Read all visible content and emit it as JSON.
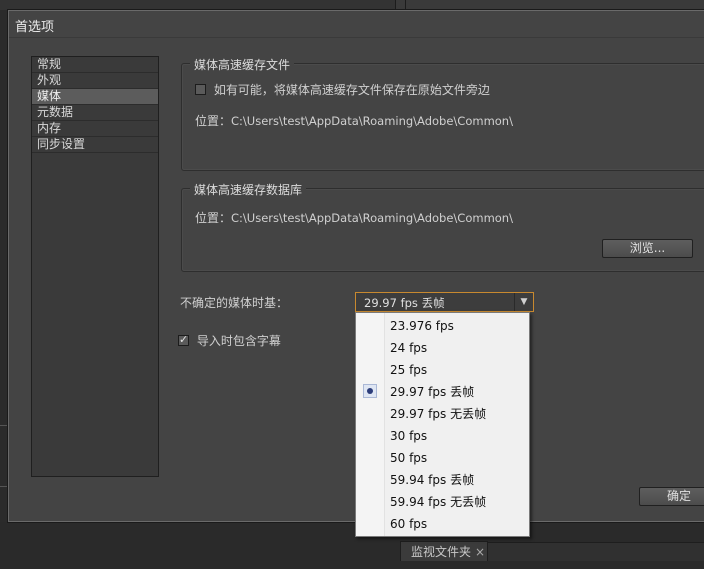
{
  "dialog": {
    "title": "首选项",
    "sidebar": {
      "items": [
        {
          "label": "常规"
        },
        {
          "label": "外观"
        },
        {
          "label": "媒体",
          "selected": true
        },
        {
          "label": "元数据"
        },
        {
          "label": "内存"
        },
        {
          "label": "同步设置"
        }
      ]
    },
    "media_cache_files": {
      "title": "媒体高速缓存文件",
      "save_next_to_originals": {
        "label": "如有可能，将媒体高速缓存文件保存在原始文件旁边",
        "checked": false
      },
      "location_label": "位置：",
      "location_value": "C:\\Users\\test\\AppData\\Roaming\\Adobe\\Common\\"
    },
    "media_cache_db": {
      "title": "媒体高速缓存数据库",
      "location_label": "位置：",
      "location_value": "C:\\Users\\test\\AppData\\Roaming\\Adobe\\Common\\",
      "browse_label": "浏览..."
    },
    "indeterminate_timebase": {
      "label": "不确定的媒体时基：",
      "selected": "29.97 fps 丢帧",
      "options": [
        "23.976 fps",
        "24 fps",
        "25 fps",
        "29.97 fps 丢帧",
        "29.97 fps 无丢帧",
        "30 fps",
        "50 fps",
        "59.94 fps 丢帧",
        "59.94 fps 无丢帧",
        "60 fps"
      ],
      "selected_index": 3
    },
    "import_captions": {
      "label": "导入时包含字幕",
      "checked": true
    },
    "ok_label": "确定"
  },
  "background": {
    "panel_tab": "监视文件夹",
    "panel_tab_close": "×"
  },
  "colors": {
    "dialog_bg": "#444444",
    "focus_border": "#c8892f",
    "dropdown_bg": "#f0f0f0",
    "selection_dot": "#2c3d7a"
  }
}
